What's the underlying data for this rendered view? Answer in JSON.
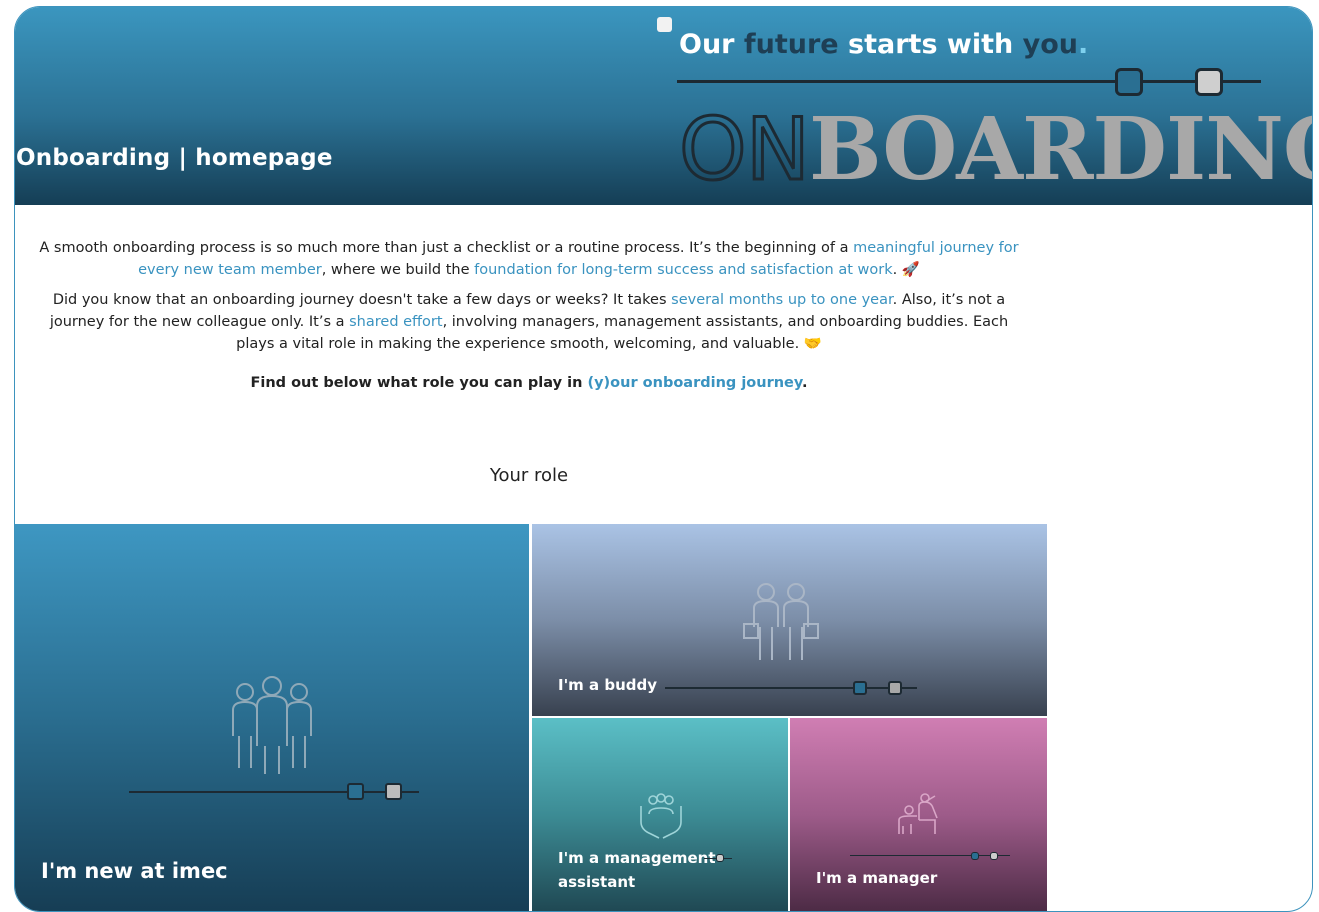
{
  "banner": {
    "page_title": "Onboarding | homepage",
    "tagline": {
      "part1": "Our ",
      "part2": "future",
      "part3": " starts with ",
      "part4": "you",
      "part5": "."
    },
    "logo": {
      "on": "ON",
      "boarding": "BOARDING"
    }
  },
  "intro": {
    "p1_a": "A smooth onboarding process is so much more than just a checklist or a routine process. It’s the beginning of a ",
    "p1_link1": "meaningful journey for every new team member",
    "p1_b": ", where we build the ",
    "p1_link2": "foundation for long-term success and satisfaction at work",
    "p1_c": ". 🚀",
    "p2_a": "Did you know that an onboarding journey doesn't take a few days or weeks? It takes ",
    "p2_link1": "several months up to one year",
    "p2_b": ". Also, it’s not a journey for the new colleague only. It’s a ",
    "p2_link2": "shared effort",
    "p2_c": ", involving managers, management assistants, and onboarding buddies. Each plays a vital role in making the experience smooth, welcoming, and valuable. 🤝",
    "find_a": "Find out below what role you can play in ",
    "find_link": "(y)our onboarding journey",
    "find_b": "."
  },
  "roles": {
    "heading": "Your role",
    "new": "I'm new at imec",
    "buddy": "I'm a buddy",
    "ma": "I'm a management assistant",
    "manager": "I'm a manager"
  },
  "colors": {
    "accent": "#3a93c0",
    "banner_top": "#3b96bf",
    "banner_bottom": "#153e55"
  },
  "icons": [
    "team-icon",
    "buddy-pair-icon",
    "hands-people-icon",
    "helping-up-icon"
  ]
}
